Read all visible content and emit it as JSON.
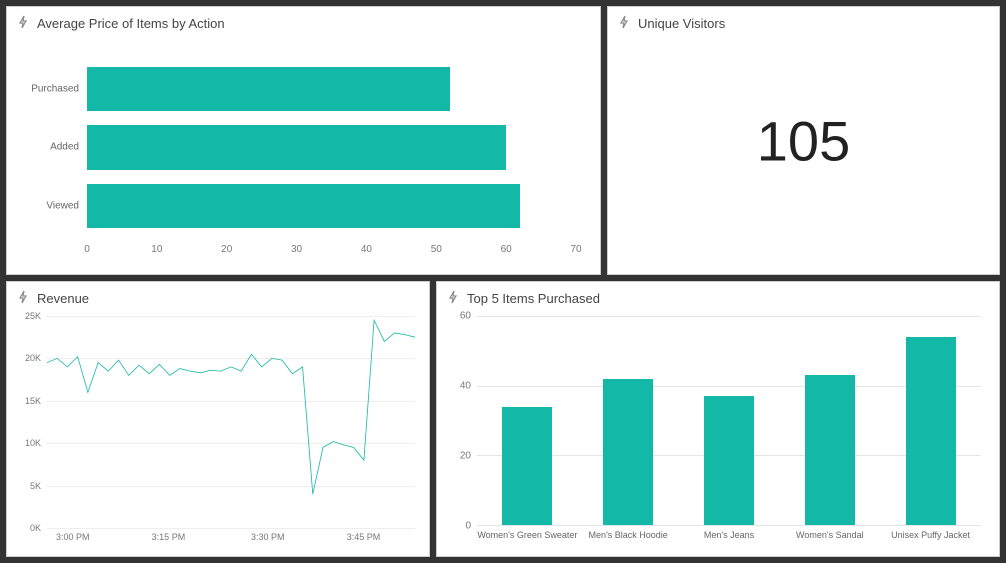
{
  "accent_color": "#14b8a6",
  "panels": {
    "avg_price": {
      "title": "Average Price of Items by Action"
    },
    "unique": {
      "title": "Unique Visitors",
      "value": "105"
    },
    "revenue": {
      "title": "Revenue"
    },
    "top5": {
      "title": "Top 5 Items Purchased"
    }
  },
  "chart_data": [
    {
      "id": "avg_price",
      "type": "bar",
      "orientation": "horizontal",
      "title": "Average Price of Items by Action",
      "categories": [
        "Purchased",
        "Added",
        "Viewed"
      ],
      "values": [
        52,
        60,
        62
      ],
      "xlabel": "",
      "ylabel": "",
      "xlim": [
        0,
        70
      ],
      "xticks": [
        0,
        10,
        20,
        30,
        40,
        50,
        60,
        70
      ]
    },
    {
      "id": "unique_visitors",
      "type": "kpi",
      "title": "Unique Visitors",
      "value": 105
    },
    {
      "id": "revenue",
      "type": "line",
      "title": "Revenue",
      "xlabel": "",
      "ylabel": "",
      "ylim": [
        0,
        25000
      ],
      "yticks": [
        0,
        5000,
        10000,
        15000,
        20000,
        25000
      ],
      "ytick_labels": [
        "0K",
        "5K",
        "10K",
        "15K",
        "20K",
        "25K"
      ],
      "xtick_labels": [
        "3:00 PM",
        "3:15 PM",
        "3:30 PM",
        "3:45 PM"
      ],
      "xtick_positions": [
        7,
        33,
        60,
        86
      ],
      "series": [
        {
          "name": "Revenue",
          "values": [
            19500,
            20000,
            19000,
            20200,
            16000,
            19500,
            18500,
            19800,
            18000,
            19200,
            18200,
            19300,
            18000,
            18800,
            18500,
            18300,
            18600,
            18500,
            19000,
            18500,
            20500,
            19000,
            20000,
            19800,
            18200,
            19000,
            4000,
            9500,
            10200,
            9800,
            9500,
            8000,
            24500,
            22000,
            23000,
            22800,
            22500
          ]
        }
      ]
    },
    {
      "id": "top5",
      "type": "bar",
      "orientation": "vertical",
      "title": "Top 5 Items Purchased",
      "categories": [
        "Women's Green Sweater",
        "Men's Black Hoodie",
        "Men's Jeans",
        "Women's Sandal",
        "Unisex Puffy Jacket"
      ],
      "values": [
        34,
        42,
        37,
        43,
        54
      ],
      "ylim": [
        0,
        60
      ],
      "yticks": [
        0,
        20,
        40,
        60
      ]
    }
  ]
}
